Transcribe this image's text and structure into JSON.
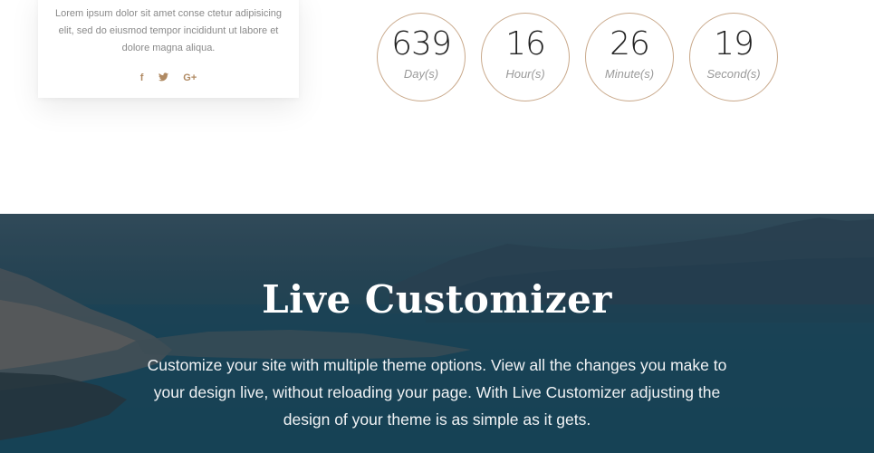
{
  "card": {
    "lines": [
      "Lorem ipsum dolor sit amet conse ctetur adipisicing",
      "elit, sed do eiusmod tempor incididunt ut labore et",
      "dolore magna aliqua."
    ],
    "social": {
      "facebook": "f",
      "twitter": "✦",
      "google": "G+"
    }
  },
  "countdown": [
    {
      "value": "639",
      "unit": "Day(s)"
    },
    {
      "value": "16",
      "unit": "Hour(s)"
    },
    {
      "value": "26",
      "unit": "Minute(s)"
    },
    {
      "value": "19",
      "unit": "Second(s)"
    }
  ],
  "hero": {
    "title": "Live Customizer",
    "lines": [
      "Customize your site with multiple theme options. View all the changes you make to",
      "your design live, without reloading your page. With Live Customizer adjusting the",
      "design of your theme is as simple as it gets."
    ]
  },
  "colors": {
    "accent": "#b08a63",
    "circle_border": "#c9a98b",
    "hero_sea": "#1f4a5e"
  }
}
